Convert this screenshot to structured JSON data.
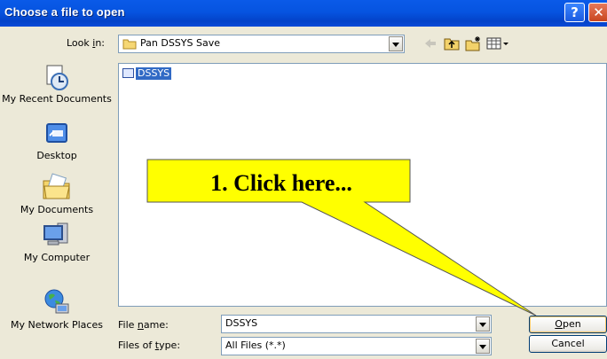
{
  "window": {
    "title": "Choose a file to open",
    "help_label": "?",
    "close_label": "✕"
  },
  "look_in": {
    "label_pre": "Look ",
    "label_key": "i",
    "label_post": "n:",
    "value": "Pan DSSYS Save"
  },
  "toolbar": {
    "icons": [
      "back-arrow-icon",
      "up-folder-icon",
      "new-folder-icon",
      "views-menu-icon"
    ]
  },
  "places": [
    {
      "label": "My Recent Documents",
      "icon": "recent-documents-icon"
    },
    {
      "label": "Desktop",
      "icon": "desktop-icon"
    },
    {
      "label": "My Documents",
      "icon": "my-documents-icon"
    },
    {
      "label": "My Computer",
      "icon": "my-computer-icon"
    },
    {
      "label": "My Network Places",
      "icon": "network-places-icon"
    }
  ],
  "files": [
    {
      "name": "DSSYS",
      "selected": true
    }
  ],
  "file_name": {
    "label_pre": "File ",
    "label_key": "n",
    "label_post": "ame:",
    "value": "DSSYS"
  },
  "file_type": {
    "label_pre": "Files of ",
    "label_key": "t",
    "label_post": "ype:",
    "value": "All Files (*.*)"
  },
  "buttons": {
    "open_key": "O",
    "open_rest": "pen",
    "cancel": "Cancel"
  },
  "callout": {
    "text": "1. Click here...",
    "fill": "#ffff00"
  }
}
